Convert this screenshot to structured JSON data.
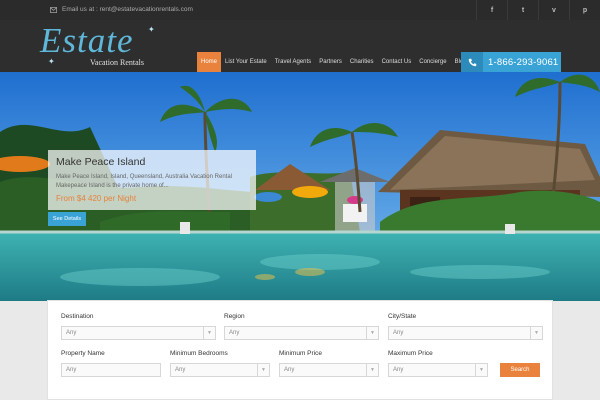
{
  "topbar": {
    "email": "Email us at : rent@estatevacationrentals.com",
    "social_icons": [
      "facebook-icon",
      "twitter-icon",
      "vimeo-icon",
      "pinterest-icon"
    ],
    "social_glyphs": [
      "f",
      "t",
      "v",
      "p"
    ]
  },
  "logo": {
    "word": "Estate",
    "subtitle": "Vacation Rentals"
  },
  "nav": {
    "items": [
      "Home",
      "List Your Estate",
      "Travel Agents",
      "Partners",
      "Charities",
      "Contact Us",
      "Concierge",
      "Blog"
    ]
  },
  "phone": {
    "number": "1-866-293-9061"
  },
  "hero": {
    "title": "Make Peace Island",
    "description": "Make Peace Island, Island, Queensland, Australia Vacation Rental Makepeace Island is the private home of...",
    "price": "From $4 420 per Night",
    "details_button": "See Details"
  },
  "search": {
    "destination": {
      "label": "Destination",
      "value": "Any"
    },
    "region": {
      "label": "Region",
      "value": "Any"
    },
    "city": {
      "label": "City/State",
      "value": "Any"
    },
    "property_name": {
      "label": "Property Name",
      "placeholder": "Any"
    },
    "min_bedrooms": {
      "label": "Minimum Bedrooms",
      "value": "Any"
    },
    "min_price": {
      "label": "Minimum Price",
      "value": "Any"
    },
    "max_price": {
      "label": "Maximum Price",
      "value": "Any"
    },
    "submit": "Search"
  },
  "colors": {
    "accent_orange": "#e8823d",
    "accent_blue": "#3aa3d6",
    "header_dark": "#2e2e2e"
  }
}
